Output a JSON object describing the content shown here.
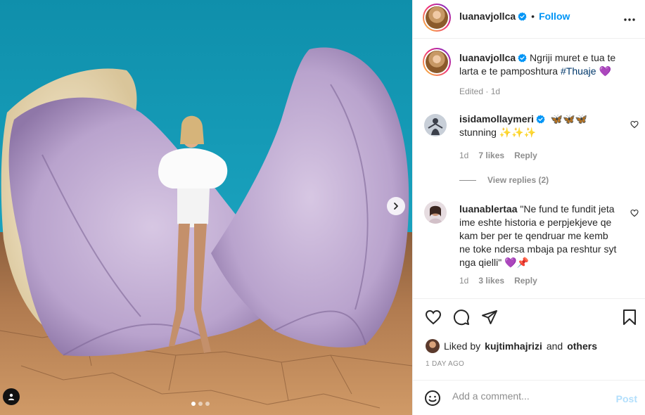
{
  "post": {
    "username": "luanavjollca",
    "follow_label": "Follow",
    "caption_username": "luanavjollca",
    "caption_text": "Ngriji muret e tua te larta e te pamposhtura",
    "caption_hashtag": "#Thuaje",
    "caption_emoji": "💜",
    "caption_meta": "Edited · 1d"
  },
  "comments": [
    {
      "username": "isidamollaymeri",
      "text_line1": "🦋🦋🦋",
      "text_line2": "stunning ✨✨✨",
      "age": "1d",
      "likes": "7 likes",
      "reply_label": "Reply",
      "view_replies": "View replies (2)"
    },
    {
      "username": "luanablertaa",
      "text": "\"Ne fund te fundit jeta ime eshte historia e perpjekjeve qe kam ber per te qendruar me kemb ne toke ndersa mbaja pa reshtur syt nga qielli\" 💜📌",
      "age": "1d",
      "likes": "3 likes",
      "reply_label": "Reply"
    }
  ],
  "likes": {
    "prefix": "Liked by",
    "user": "kujtimhajrizi",
    "and": "and",
    "others": "others"
  },
  "date_label": "1 DAY AGO",
  "comment_input": {
    "placeholder": "Add a comment...",
    "post_label": "Post"
  },
  "carousel": {
    "total_slides": 3,
    "active_slide": 1
  },
  "icons": {
    "verified": "verified-badge-icon",
    "more": "more-options-icon",
    "heart": "heart-icon",
    "comment": "comment-icon",
    "share": "share-icon",
    "save": "bookmark-icon",
    "emoji": "emoji-icon",
    "next": "chevron-right-icon",
    "tag": "user-tag-icon"
  },
  "colors": {
    "link_blue": "#0095f6",
    "hashtag": "#00376b",
    "muted": "#8e8e8e",
    "post_disabled": "#b2dffc"
  }
}
